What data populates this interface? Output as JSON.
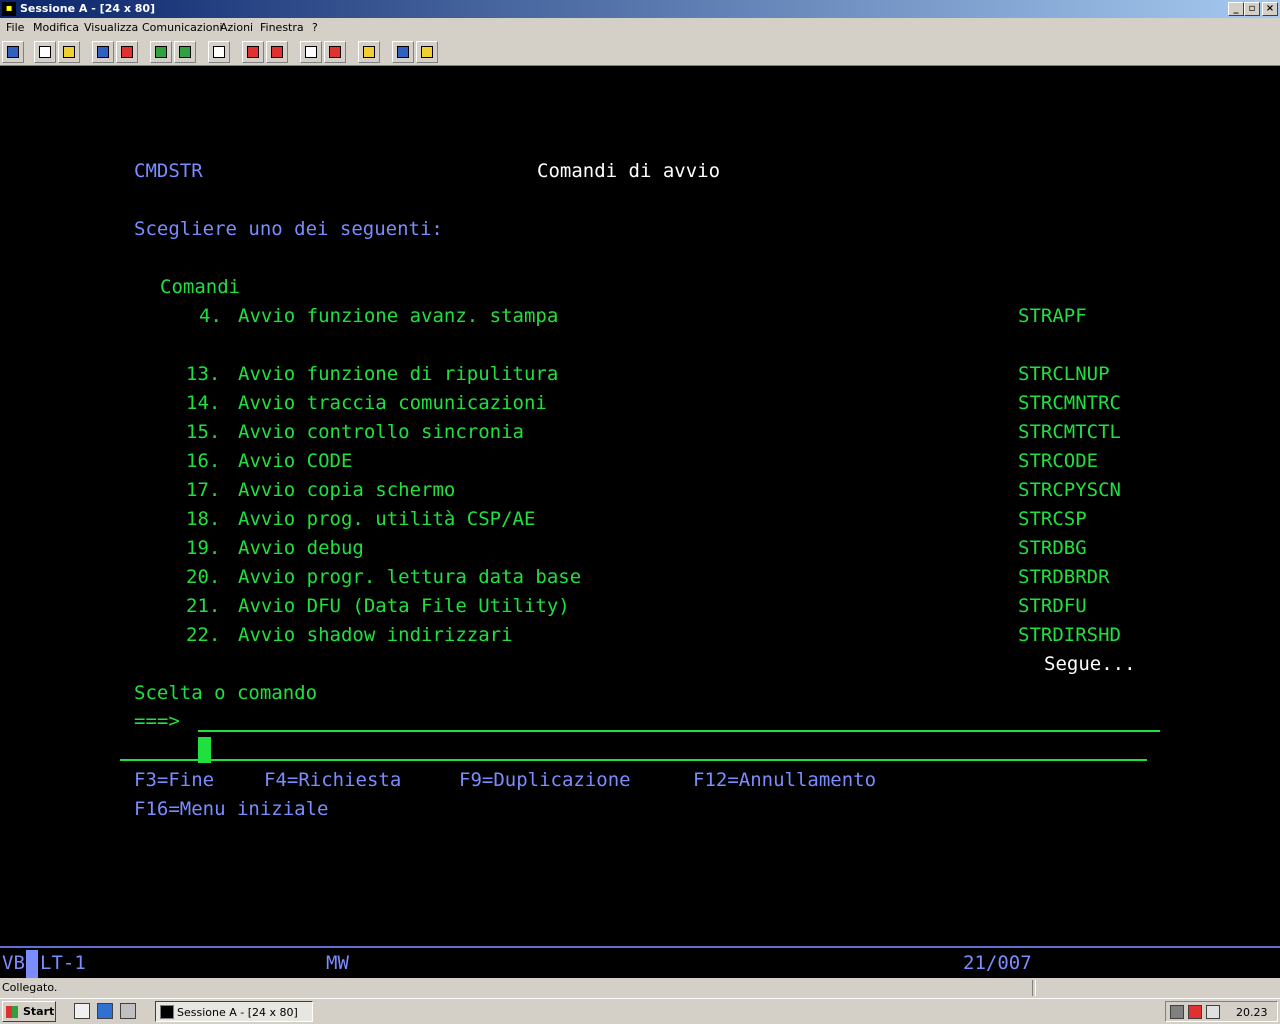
{
  "window": {
    "title": "Sessione A - [24 x 80]",
    "controls": {
      "minimize": "_",
      "restore": "▫",
      "close": "×"
    }
  },
  "menu": [
    "File",
    "Modifica",
    "Visualizza",
    "Comunicazioni",
    "Azioni",
    "Finestra",
    "?"
  ],
  "toolbar_icons": [
    "print-screen-icon",
    "copy-icon",
    "paste-icon",
    "send-icon",
    "receive-icon",
    "display-icon",
    "keypad-icon",
    "macro-icon",
    "record-macro-icon",
    "play-macro-icon",
    "stop-macro-icon",
    "edit-macro-icon",
    "clipboard-icon",
    "globe-icon",
    "help-icon"
  ],
  "screen": {
    "screen_id": "CMDSTR",
    "title": "Comandi di avvio",
    "prompt": "Scegliere uno dei seguenti:",
    "section": "Comandi",
    "options": [
      {
        "num": "4.",
        "desc": "Avvio funzione avanz. stampa",
        "cmd": "STRAPF"
      },
      {
        "num": "13.",
        "desc": "Avvio funzione di ripulitura",
        "cmd": "STRCLNUP"
      },
      {
        "num": "14.",
        "desc": "Avvio traccia comunicazioni",
        "cmd": "STRCMNTRC"
      },
      {
        "num": "15.",
        "desc": "Avvio controllo sincronia",
        "cmd": "STRCMTCTL"
      },
      {
        "num": "16.",
        "desc": "Avvio CODE",
        "cmd": "STRCODE"
      },
      {
        "num": "17.",
        "desc": "Avvio copia schermo",
        "cmd": "STRCPYSCN"
      },
      {
        "num": "18.",
        "desc": "Avvio prog. utilità CSP/AE",
        "cmd": "STRCSP"
      },
      {
        "num": "19.",
        "desc": "Avvio debug",
        "cmd": "STRDBG"
      },
      {
        "num": "20.",
        "desc": "Avvio progr. lettura data base",
        "cmd": "STRDBRDR"
      },
      {
        "num": "21.",
        "desc": "Avvio DFU (Data File Utility)",
        "cmd": "STRDFU"
      },
      {
        "num": "22.",
        "desc": "Avvio shadow indirizzari",
        "cmd": "STRDIRSHD"
      }
    ],
    "more": "Segue...",
    "command_label": "Scelta o comando",
    "command_prompt": "===>",
    "command_value": "",
    "fkeys_line1": [
      "F3=Fine",
      "F4=Richiesta",
      "F9=Duplicazione",
      "F12=Annullamento"
    ],
    "fkeys_line2": [
      "F16=Menu iniziale"
    ]
  },
  "oia": {
    "session_indicator": "VB",
    "device": "LT-1",
    "mode": "MW",
    "cursor_position": "21/007"
  },
  "status": {
    "message": "Collegato."
  },
  "taskbar": {
    "start_label": "Start",
    "task_label": "Sessione A - [24 x 80]",
    "clock": "20.23"
  },
  "colors": {
    "terminal_bg": "#000000",
    "blue_text": "#7b8cff",
    "green_text": "#20e040",
    "white_text": "#ffffff",
    "title_bar": "#0a246a"
  }
}
